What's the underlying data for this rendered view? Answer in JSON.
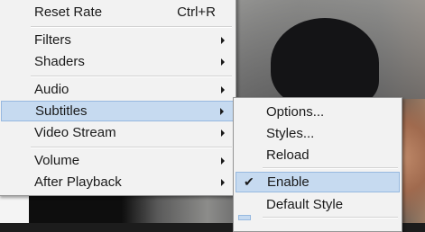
{
  "main_menu": {
    "items": [
      {
        "label": "Reset Rate",
        "shortcut": "Ctrl+R"
      },
      {
        "label": "Filters"
      },
      {
        "label": "Shaders"
      },
      {
        "label": "Audio"
      },
      {
        "label": "Subtitles"
      },
      {
        "label": "Video Stream"
      },
      {
        "label": "Volume"
      },
      {
        "label": "After Playback"
      }
    ]
  },
  "subtitles_menu": {
    "items": [
      {
        "label": "Options..."
      },
      {
        "label": "Styles..."
      },
      {
        "label": "Reload"
      },
      {
        "label": "Enable",
        "checked": true,
        "check_glyph": "✔"
      },
      {
        "label": "Default Style"
      }
    ]
  },
  "colors": {
    "menu_background": "#f2f2f2",
    "highlight": "#c6daf0",
    "highlight_border": "#97b9e0"
  }
}
